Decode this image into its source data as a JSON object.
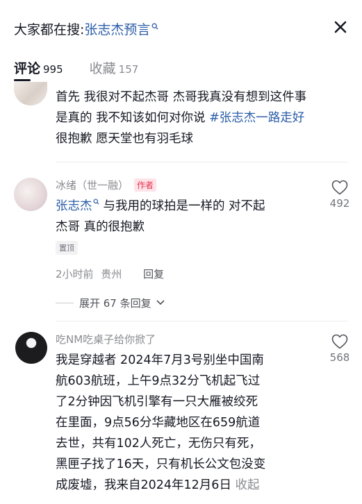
{
  "header": {
    "prefix": "大家都在搜:",
    "query": "张志杰预言"
  },
  "tabs": [
    {
      "label": "评论",
      "count": "995"
    },
    {
      "label": "收藏",
      "count": "157"
    }
  ],
  "comments": [
    {
      "lines": [
        "首先 我很对不起杰哥 杰哥我真没有想到这件事",
        "是真的 我不知该如何对你说 "
      ],
      "hashtag": "#张志杰一路走好",
      "tail": "很抱歉 愿天堂也有羽毛球"
    },
    {
      "username": "冰绪（世一融）",
      "badge": "作者",
      "mention": "张志杰",
      "text_after_mention": "与我用的球拍是一样的 对不起",
      "line2": "杰哥 真的很抱歉",
      "pinned": "置顶",
      "time": "2小时前",
      "location": "贵州",
      "reply": "回复",
      "likes": "492",
      "expand": "展开 67 条回复"
    },
    {
      "username": "吃NM吃桌子给你掀了",
      "lines": [
        "我是穿越者 2024年7月3号别坐中国南",
        "航603航班，上午9点32分飞机起飞过",
        "了2分钟因飞机引擎有一只大雁被绞死",
        "在里面，9点56分华藏地区在659航道",
        "去世，共有102人死亡，无伤只有死，",
        "黑匣子找了16天，只有机长公文包没变",
        "成废墟，我来自2024年12月6日 "
      ],
      "collapse": "收起",
      "likes": "568"
    }
  ],
  "icons": {
    "search_small": "search-icon",
    "close": "close-icon",
    "like": "heart-icon",
    "expand_chevron": "chevron-down-icon"
  },
  "colors": {
    "link": "#2b5da8",
    "author_badge_bg": "#fde3e8",
    "author_badge_text": "#e8324c",
    "muted": "#8a8b91"
  }
}
